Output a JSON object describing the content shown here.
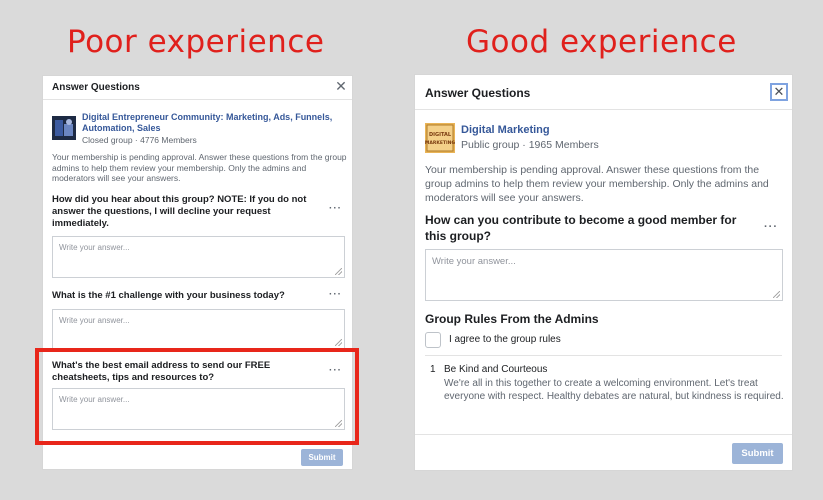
{
  "headings": {
    "poor": "Poor experience",
    "good": "Good experience"
  },
  "poor": {
    "title": "Answer Questions",
    "group_name": "Digital Entrepreneur Community: Marketing, Ads, Funnels, Automation, Sales",
    "group_meta": "Closed group · 4776 Members",
    "description": "Your membership is pending approval. Answer these questions from the group admins to help them review your membership. Only the admins and moderators will see your answers.",
    "questions": [
      "How did you hear about this group? NOTE: If you do not answer the questions, I will decline your request immediately.",
      "What is the #1 challenge with your business today?",
      "What's the best email address to send our FREE cheatsheets, tips and resources to?"
    ],
    "placeholder": "Write your answer...",
    "more_label": "···",
    "submit_label": "Submit"
  },
  "good": {
    "title": "Answer Questions",
    "group_name": "Digital Marketing",
    "group_meta": "Public group · 1965 Members",
    "avatar_text": "DIGITAL MARKETING",
    "description": "Your membership is pending approval. Answer these questions from the group admins to help them review your membership. Only the admins and moderators will see your answers.",
    "question": "How can you contribute to become a good member for this group?",
    "placeholder": "Write your answer...",
    "more_label": "···",
    "rules_heading": "Group Rules From the Admins",
    "agree_label": "I agree to the group rules",
    "rule": {
      "number": "1",
      "title": "Be Kind and Courteous",
      "text": "We're all in this together to create a welcoming environment. Let's treat everyone with respect. Healthy debates are natural, but kindness is required."
    },
    "submit_label": "Submit"
  },
  "colors": {
    "heading_red": "#e0201c",
    "highlight_red": "#e8261a",
    "link_blue": "#365899",
    "submit_disabled": "#9cb4d8"
  },
  "icons": {
    "close": "close-icon",
    "more": "more-options-icon",
    "checkbox": "checkbox-icon"
  }
}
